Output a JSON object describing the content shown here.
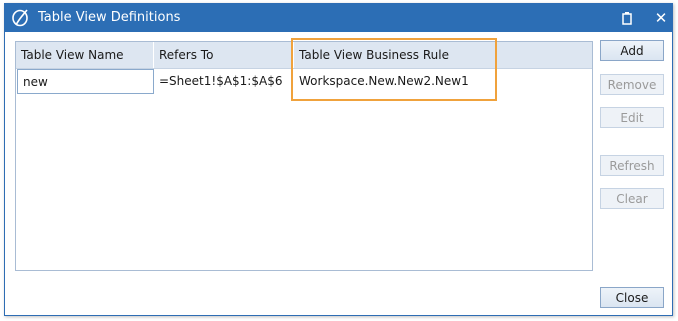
{
  "window": {
    "title": "Table View Definitions"
  },
  "grid": {
    "columns": [
      "Table View Name",
      "Refers To",
      "Table View Business Rule"
    ],
    "rows": [
      [
        "new",
        "=Sheet1!$A$1:$A$6",
        "Workspace.New.New2.New1"
      ]
    ]
  },
  "buttons": {
    "add": "Add",
    "remove": "Remove",
    "edit": "Edit",
    "refresh": "Refresh",
    "clear": "Clear",
    "close": "Close"
  },
  "colors": {
    "titlebar": "#2c6eb5",
    "highlight": "#f0a23c",
    "header": "#dde6f1"
  }
}
